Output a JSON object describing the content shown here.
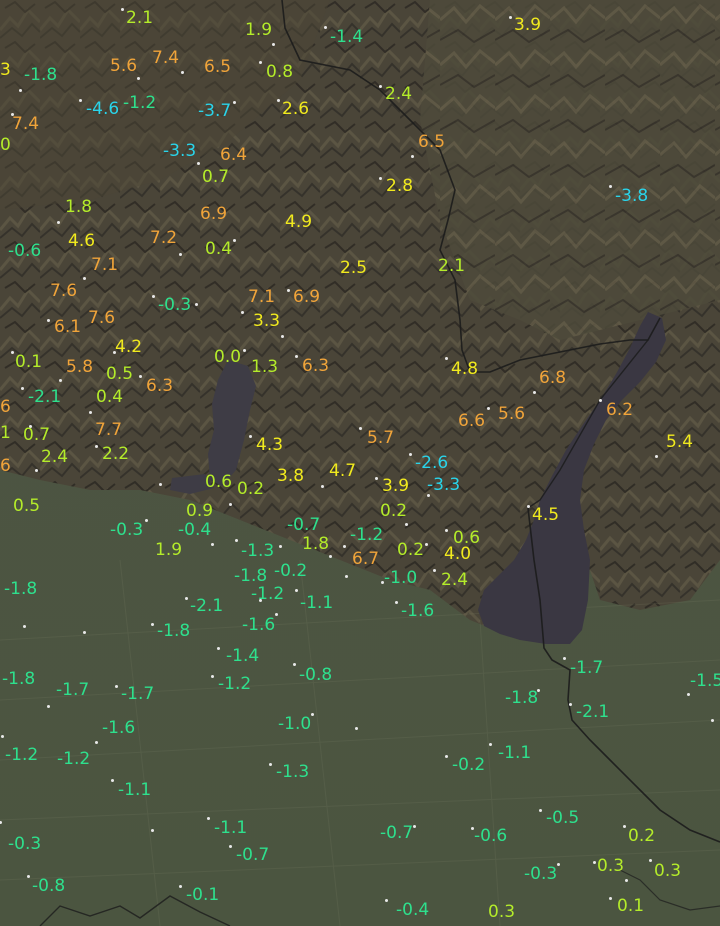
{
  "map": {
    "colors": {
      "mountain": "#4a4436",
      "plain": "#4d5540",
      "lake": "#3d3a44",
      "border": "#1a1a1a",
      "station_dot": "#e8e8e8"
    },
    "temperature_color_scale": [
      {
        "min": -99,
        "max": -2.5,
        "color": "#29d4ea"
      },
      {
        "min": -2.5,
        "max": 0,
        "color": "#2ee08d"
      },
      {
        "min": 0,
        "max": 2.5,
        "color": "#b4ec2a"
      },
      {
        "min": 2.5,
        "max": 5.5,
        "color": "#f1ea1e"
      },
      {
        "min": 5.5,
        "max": 99,
        "color": "#f0a43a"
      }
    ],
    "stations": [
      {
        "id": "s1",
        "value": "2.1"
      },
      {
        "id": "s2",
        "value": "1.9"
      },
      {
        "id": "s3",
        "value": "-1.4"
      },
      {
        "id": "s4",
        "value": "3.9"
      },
      {
        "id": "s5",
        "value": "-1.8"
      },
      {
        "id": "s6",
        "value": "5.6"
      },
      {
        "id": "s7",
        "value": "7.4"
      },
      {
        "id": "s8",
        "value": "6.5"
      },
      {
        "id": "s9",
        "value": "0.8"
      },
      {
        "id": "s10",
        "value": "-4.6"
      },
      {
        "id": "s11",
        "value": "-1.2"
      },
      {
        "id": "s12",
        "value": "-3.7"
      },
      {
        "id": "s13",
        "value": "2.6"
      },
      {
        "id": "s14",
        "value": "2.4"
      },
      {
        "id": "s15",
        "value": "7.4"
      },
      {
        "id": "s16",
        "value": "6.5"
      },
      {
        "id": "s17",
        "value": "-3.3"
      },
      {
        "id": "s18",
        "value": "6.4"
      },
      {
        "id": "s19",
        "value": "0.7"
      },
      {
        "id": "s20",
        "value": "2.8"
      },
      {
        "id": "s21",
        "value": "-3.8"
      },
      {
        "id": "s22",
        "value": "1.8"
      },
      {
        "id": "s23",
        "value": "6.9"
      },
      {
        "id": "s24",
        "value": "4.9"
      },
      {
        "id": "s25",
        "value": "-0.6"
      },
      {
        "id": "s26",
        "value": "4.6"
      },
      {
        "id": "s27",
        "value": "7.2"
      },
      {
        "id": "s28",
        "value": "0.4"
      },
      {
        "id": "s29",
        "value": "7.1"
      },
      {
        "id": "s30",
        "value": "2.5"
      },
      {
        "id": "s31",
        "value": "2.1"
      },
      {
        "id": "s32",
        "value": "7.6"
      },
      {
        "id": "s33",
        "value": "-0.3"
      },
      {
        "id": "s34",
        "value": "7.1"
      },
      {
        "id": "s35",
        "value": "6.9"
      },
      {
        "id": "s36",
        "value": "6.1"
      },
      {
        "id": "s37",
        "value": "7.6"
      },
      {
        "id": "s38",
        "value": "3.3"
      },
      {
        "id": "s39",
        "value": "4.2"
      },
      {
        "id": "s40",
        "value": "0.1"
      },
      {
        "id": "s41",
        "value": "5.8"
      },
      {
        "id": "s42",
        "value": "0.0"
      },
      {
        "id": "s43",
        "value": "1.3"
      },
      {
        "id": "s44",
        "value": "6.3"
      },
      {
        "id": "s45",
        "value": "4.8"
      },
      {
        "id": "s46",
        "value": "0.5"
      },
      {
        "id": "s47",
        "value": "6.8"
      },
      {
        "id": "s48",
        "value": "6.3"
      },
      {
        "id": "s49",
        "value": "-2.1"
      },
      {
        "id": "s50",
        "value": "0.4"
      },
      {
        "id": "s51",
        "value": "6.2"
      },
      {
        "id": "s52",
        "value": "5.6"
      },
      {
        "id": "s53",
        "value": "6.6"
      },
      {
        "id": "s54",
        "value": "7.7"
      },
      {
        "id": "s55",
        "value": "5.7"
      },
      {
        "id": "s56",
        "value": "0.7"
      },
      {
        "id": "s57",
        "value": "4.3"
      },
      {
        "id": "s58",
        "value": "5.4"
      },
      {
        "id": "s59",
        "value": "2.4"
      },
      {
        "id": "s60",
        "value": "2.2"
      },
      {
        "id": "s61",
        "value": "-2.6"
      },
      {
        "id": "s62",
        "value": "4.7"
      },
      {
        "id": "s63",
        "value": "3.8"
      },
      {
        "id": "s64",
        "value": "0.6"
      },
      {
        "id": "s65",
        "value": "0.2"
      },
      {
        "id": "s66",
        "value": "3.9"
      },
      {
        "id": "s67",
        "value": "-3.3"
      },
      {
        "id": "s68",
        "value": "0.5"
      },
      {
        "id": "s69",
        "value": "0.9"
      },
      {
        "id": "s70",
        "value": "0.2"
      },
      {
        "id": "s71",
        "value": "4.5"
      },
      {
        "id": "s72",
        "value": "-0.3"
      },
      {
        "id": "s73",
        "value": "-0.4"
      },
      {
        "id": "s74",
        "value": "-0.7"
      },
      {
        "id": "s75",
        "value": "-1.2"
      },
      {
        "id": "s76",
        "value": "0.6"
      },
      {
        "id": "s77",
        "value": "1.9"
      },
      {
        "id": "s78",
        "value": "-1.3"
      },
      {
        "id": "s79",
        "value": "1.8"
      },
      {
        "id": "s80",
        "value": "6.7"
      },
      {
        "id": "s81",
        "value": "0.2"
      },
      {
        "id": "s82",
        "value": "4.0"
      },
      {
        "id": "s83",
        "value": "-1.8"
      },
      {
        "id": "s84",
        "value": "-1.8"
      },
      {
        "id": "s85",
        "value": "-0.2"
      },
      {
        "id": "s86",
        "value": "-1.0"
      },
      {
        "id": "s87",
        "value": "2.4"
      },
      {
        "id": "s88",
        "value": "-2.1"
      },
      {
        "id": "s89",
        "value": "-1.2"
      },
      {
        "id": "s90",
        "value": "-1.1"
      },
      {
        "id": "s91",
        "value": "-1.6"
      },
      {
        "id": "s92",
        "value": "-1.8"
      },
      {
        "id": "s93",
        "value": "-1.6"
      },
      {
        "id": "s94",
        "value": "-1.4"
      },
      {
        "id": "s95",
        "value": "-1.7"
      },
      {
        "id": "s96",
        "value": "-0.8"
      },
      {
        "id": "s97",
        "value": "-1.8"
      },
      {
        "id": "s98",
        "value": "-1.7"
      },
      {
        "id": "s99",
        "value": "-1.7"
      },
      {
        "id": "s100",
        "value": "-1.2"
      },
      {
        "id": "s101",
        "value": "-1.8"
      },
      {
        "id": "s102",
        "value": "-2.1"
      },
      {
        "id": "s103",
        "value": "-1.6"
      },
      {
        "id": "s104",
        "value": "-1.0"
      },
      {
        "id": "s105",
        "value": "-1.2"
      },
      {
        "id": "s106",
        "value": "-1.2"
      },
      {
        "id": "s107",
        "value": "-1.3"
      },
      {
        "id": "s108",
        "value": "-0.2"
      },
      {
        "id": "s109",
        "value": "-1.1"
      },
      {
        "id": "s110",
        "value": "-1.1"
      },
      {
        "id": "s111",
        "value": "-1.1"
      },
      {
        "id": "s112",
        "value": "-0.5"
      },
      {
        "id": "s113",
        "value": "-0.7"
      },
      {
        "id": "s114",
        "value": "-0.6"
      },
      {
        "id": "s115",
        "value": "0.2"
      },
      {
        "id": "s116",
        "value": "-0.3"
      },
      {
        "id": "s117",
        "value": "-0.7"
      },
      {
        "id": "s118",
        "value": "0.3"
      },
      {
        "id": "s119",
        "value": "0.3"
      },
      {
        "id": "s120",
        "value": "-0.3"
      },
      {
        "id": "s121",
        "value": "-0.8"
      },
      {
        "id": "s122",
        "value": "-0.1"
      },
      {
        "id": "s123",
        "value": "-0.4"
      },
      {
        "id": "s124",
        "value": "0.3"
      },
      {
        "id": "s125",
        "value": "0.1"
      },
      {
        "id": "s126",
        "value": "-1.5"
      },
      {
        "id": "s127",
        "value": "3"
      },
      {
        "id": "s128",
        "value": "0"
      },
      {
        "id": "s129",
        "value": "6"
      },
      {
        "id": "s130",
        "value": "1"
      },
      {
        "id": "s131",
        "value": "6"
      }
    ]
  }
}
